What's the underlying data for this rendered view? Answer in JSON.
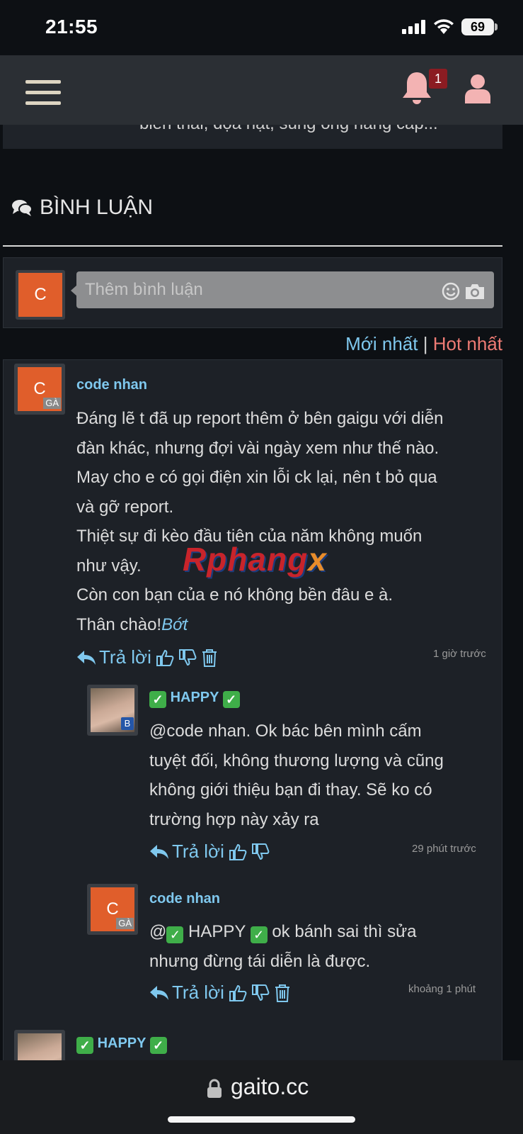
{
  "status_bar": {
    "time": "21:55",
    "battery": "69"
  },
  "nav": {
    "notification_count": "1"
  },
  "article_tail": "biến thái, dọa hạt, súng ống hàng cấp...",
  "section": {
    "title": "BÌNH LUẬN"
  },
  "composer": {
    "avatar_letter": "C",
    "placeholder": "Thêm bình luận"
  },
  "sort": {
    "newest": "Mới nhất",
    "separator": "|",
    "hot": "Hot nhất"
  },
  "reply_label": "Trả lời",
  "watermark": {
    "main": "Rphang",
    "accent": "x"
  },
  "comments": [
    {
      "author": "code nhan",
      "avatar_letter": "C",
      "avatar_badge": "GÀ",
      "lines": [
        "Đáng lẽ t đã up report thêm ở bên gaigu với diễn",
        "đàn khác, nhưng đợi vài ngày xem như thế nào.",
        "May cho e có gọi điện xin lỗi ck lại, nên t bỏ qua",
        "và gỡ report.",
        "Thiệt sự đi kèo đầu tiên của năm không muốn",
        "như vậy.",
        "Còn con bạn của e nó không bền đâu e à.",
        "Thân chào!"
      ],
      "less_link": "Bớt",
      "time": "1 giờ trước"
    },
    {
      "author": "HAPPY",
      "avatar_badge": "B",
      "lines": [
        "@code nhan. Ok bác bên mình cấm",
        "tuyệt đối, không thương lượng và cũng",
        "không giới thiệu bạn đi thay. Sẽ ko có",
        "trường hợp này xảy ra"
      ],
      "time": "29 phút trước"
    },
    {
      "author": "code nhan",
      "avatar_letter": "C",
      "avatar_badge": "GÀ",
      "mention": "@",
      "mention_name": "HAPPY",
      "line1_rest": "ok bánh sai thì sửa",
      "line2": "nhưng đừng tái diễn là được.",
      "time": "khoảng 1 phút"
    },
    {
      "author": "HAPPY"
    }
  ],
  "browser": {
    "url": "gaito.cc"
  }
}
